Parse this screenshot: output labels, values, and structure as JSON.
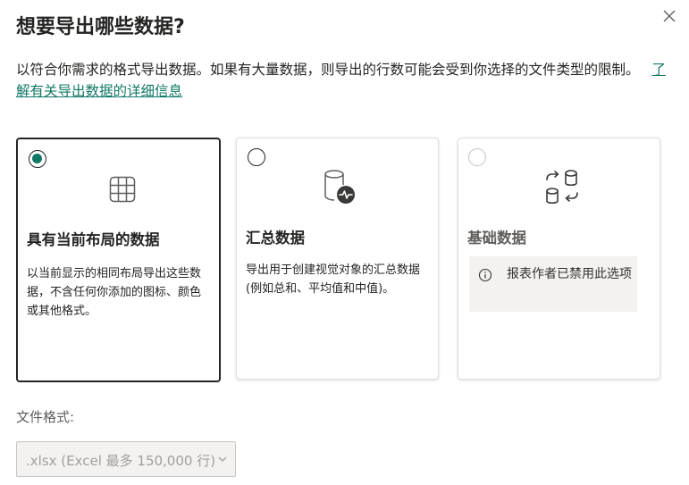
{
  "dialog": {
    "title": "想要导出哪些数据?",
    "description": "以符合你需求的格式导出数据。如果有大量数据，则导出的行数可能会受到你选择的文件类型的限制。",
    "learn_more_link": "了解有关导出数据的详细信息"
  },
  "options": [
    {
      "title": "具有当前布局的数据",
      "description": "以当前显示的相同布局导出这些数据，不含任何你添加的图标、颜色或其他格式。",
      "icon": "table-grid-icon",
      "selected": true,
      "disabled": false
    },
    {
      "title": "汇总数据",
      "description": "导出用于创建视觉对象的汇总数据(例如总和、平均值和中值)。",
      "icon": "database-pulse-icon",
      "selected": false,
      "disabled": false
    },
    {
      "title": "基础数据",
      "notice": "报表作者已禁用此选项",
      "icon": "database-sync-icon",
      "selected": false,
      "disabled": true
    }
  ],
  "file_format": {
    "label": "文件格式:",
    "selected": ".xlsx (Excel 最多 150,000 行)"
  },
  "colors": {
    "accent": "#117865",
    "text": "#252423",
    "disabled_border": "#c8c6c4",
    "notice_bg": "#f3f2f1"
  }
}
